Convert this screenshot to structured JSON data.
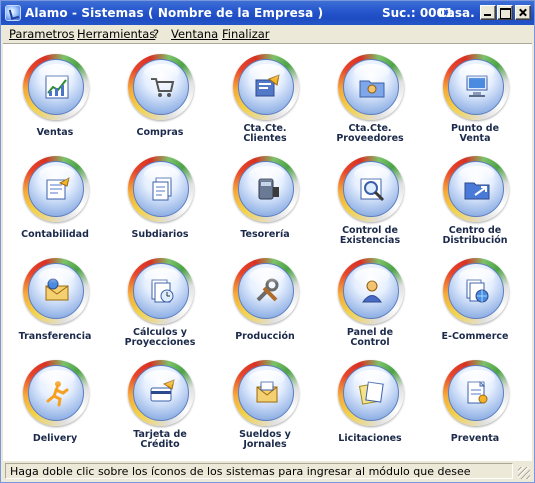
{
  "window": {
    "title": "Alamo - Sistemas   ( Nombre de la Empresa )",
    "branch": "Suc.: 0001",
    "user": "Casa..."
  },
  "menu": [
    {
      "label": "Parametros"
    },
    {
      "label": "Herramientas"
    },
    {
      "label": "?"
    },
    {
      "label": "Ventana"
    },
    {
      "label": "Finalizar"
    }
  ],
  "modules": [
    {
      "label": "Ventas",
      "icon": "sales-chart-icon"
    },
    {
      "label": "Compras",
      "icon": "shopping-cart-icon"
    },
    {
      "label": "Cta.Cte.\nClientes",
      "icon": "client-account-icon"
    },
    {
      "label": "Cta.Cte.\nProveedores",
      "icon": "supplier-folder-icon"
    },
    {
      "label": "Punto de\nVenta",
      "icon": "point-of-sale-icon"
    },
    {
      "label": "Contabilidad",
      "icon": "ledger-icon"
    },
    {
      "label": "Subdiarios",
      "icon": "documents-icon"
    },
    {
      "label": "Tesorería",
      "icon": "treasury-icon"
    },
    {
      "label": "Control de\nExistencias",
      "icon": "stock-search-icon"
    },
    {
      "label": "Centro de\nDistribución",
      "icon": "distribution-folder-icon"
    },
    {
      "label": "Transferencia",
      "icon": "transfer-mail-icon"
    },
    {
      "label": "Cálculos y\nProyecciones",
      "icon": "calculations-clock-icon"
    },
    {
      "label": "Producción",
      "icon": "tools-icon"
    },
    {
      "label": "Panel de\nControl",
      "icon": "control-panel-user-icon"
    },
    {
      "label": "E-Commerce",
      "icon": "ecommerce-globe-icon"
    },
    {
      "label": "Delivery",
      "icon": "delivery-runner-icon"
    },
    {
      "label": "Tarjeta de\nCrédito",
      "icon": "credit-card-icon"
    },
    {
      "label": "Sueldos y\nJornales",
      "icon": "payroll-envelope-icon"
    },
    {
      "label": "Licitaciones",
      "icon": "tenders-papers-icon"
    },
    {
      "label": "Preventa",
      "icon": "presale-document-icon"
    }
  ],
  "status": {
    "text": "Haga doble clic sobre los íconos de los sistemas para ingresar al módulo que desee"
  }
}
